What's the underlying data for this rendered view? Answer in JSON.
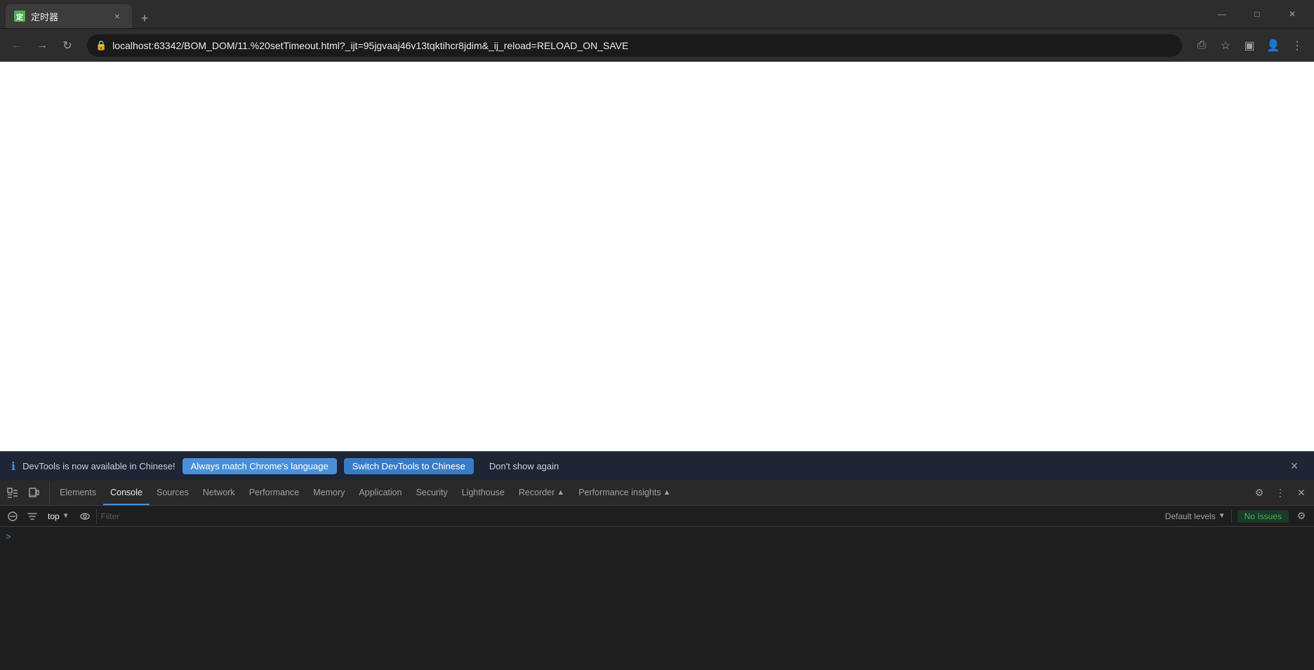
{
  "titleBar": {
    "tab": {
      "favicon_label": "定",
      "title": "定时器",
      "close_label": "×"
    },
    "new_tab_label": "+",
    "window_controls": {
      "minimize": "—",
      "maximize": "□",
      "close": "✕"
    }
  },
  "navBar": {
    "back_label": "←",
    "forward_label": "→",
    "reload_label": "↻",
    "url": "localhost:63342/BOM_DOM/11.%20setTimeout.html?_ijt=95jgvaaj46v13tqktihcr8jdim&_ij_reload=RELOAD_ON_SAVE",
    "share_label": "⎙",
    "bookmark_label": "☆",
    "extension_label": "▣",
    "account_label": "👤",
    "menu_label": "⋮"
  },
  "banner": {
    "info_icon": "ℹ",
    "message": "DevTools is now available in Chinese!",
    "btn_primary": "Always match Chrome's language",
    "btn_secondary": "Switch DevTools to Chinese",
    "btn_dismiss": "Don't show again",
    "close_label": "×"
  },
  "devtools": {
    "left_icon1": "⬚",
    "left_icon2": "⊡",
    "tabs": [
      {
        "label": "Elements",
        "active": false
      },
      {
        "label": "Console",
        "active": true
      },
      {
        "label": "Sources",
        "active": false
      },
      {
        "label": "Network",
        "active": false
      },
      {
        "label": "Performance",
        "active": false
      },
      {
        "label": "Memory",
        "active": false
      },
      {
        "label": "Application",
        "active": false
      },
      {
        "label": "Security",
        "active": false
      },
      {
        "label": "Lighthouse",
        "active": false
      },
      {
        "label": "Recorder",
        "active": false
      },
      {
        "label": "Performance insights",
        "active": false
      }
    ],
    "right_icon_settings": "⚙",
    "right_icon_more": "⋮",
    "right_icon_close": "✕"
  },
  "consoleToolbar": {
    "clear_label": "🚫",
    "filter_placeholder": "Filter",
    "context_label": "top",
    "eye_label": "👁",
    "levels_label": "Default levels",
    "no_issues_label": "No Issues",
    "settings_label": "⚙"
  },
  "consoleBody": {
    "prompt_arrow": ">"
  }
}
